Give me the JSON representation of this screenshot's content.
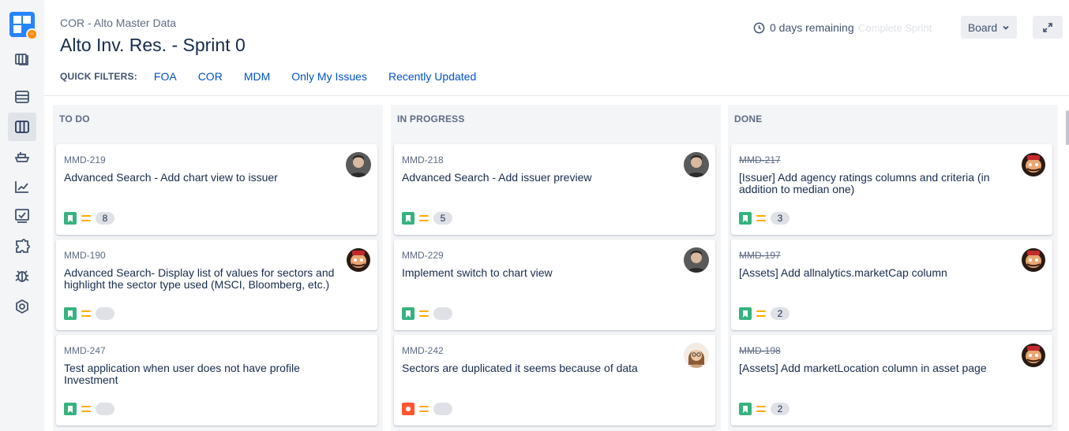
{
  "header": {
    "breadcrumb": "COR - Alto Master Data",
    "title": "Alto Inv. Res. - Sprint 0",
    "remaining": "0 days remaining",
    "complete_sprint": "Complete Sprint",
    "board_button": "Board"
  },
  "quick_filters": {
    "label": "QUICK FILTERS:",
    "items": [
      "FOA",
      "COR",
      "MDM",
      "Only My Issues",
      "Recently Updated"
    ]
  },
  "sidebar": {
    "icons": [
      "backlog-icon",
      "releases-icon",
      "board-icon",
      "ship-icon",
      "reports-icon",
      "issues-icon",
      "addons-icon",
      "bug-icon",
      "settings-icon"
    ]
  },
  "columns": [
    {
      "title": "TO DO",
      "cards": [
        {
          "key": "MMD-219",
          "summary": "Advanced Search - Add chart view to issuer",
          "type": "story",
          "estimate": "8",
          "avatar": "man"
        },
        {
          "key": "MMD-190",
          "summary": "Advanced Search- Display list of values for sectors and highlight the sector type used (MSCI, Bloomberg, etc.)",
          "type": "story",
          "estimate": "",
          "avatar": "mascot"
        },
        {
          "key": "MMD-247",
          "summary": "Test application when user does not have profile Investment",
          "type": "story",
          "estimate": "",
          "avatar": ""
        }
      ]
    },
    {
      "title": "IN PROGRESS",
      "cards": [
        {
          "key": "MMD-218",
          "summary": "Advanced Search - Add issuer preview",
          "type": "story",
          "estimate": "5",
          "avatar": "man"
        },
        {
          "key": "MMD-229",
          "summary": "Implement switch to chart view",
          "type": "story",
          "estimate": "",
          "avatar": "man"
        },
        {
          "key": "MMD-242",
          "summary": "Sectors are duplicated it seems because of data",
          "type": "bug",
          "estimate": "",
          "avatar": "woman"
        }
      ]
    },
    {
      "title": "DONE",
      "cards": [
        {
          "key": "MMD-217",
          "summary": "[Issuer] Add agency ratings columns and criteria (in addition to median one)",
          "type": "story",
          "estimate": "3",
          "avatar": "mascot"
        },
        {
          "key": "MMD-197",
          "summary": "[Assets] Add allnalytics.marketCap column",
          "type": "story",
          "estimate": "2",
          "avatar": "mascot"
        },
        {
          "key": "MMD-198",
          "summary": "[Assets] Add marketLocation column in asset page",
          "type": "story",
          "estimate": "2",
          "avatar": "mascot"
        }
      ]
    }
  ],
  "colors": {
    "accent_link": "#0052cc",
    "story": "#36b37e",
    "bug": "#ff5630",
    "priority_medium": "#ffab00",
    "column_bg": "#f4f5f7"
  }
}
